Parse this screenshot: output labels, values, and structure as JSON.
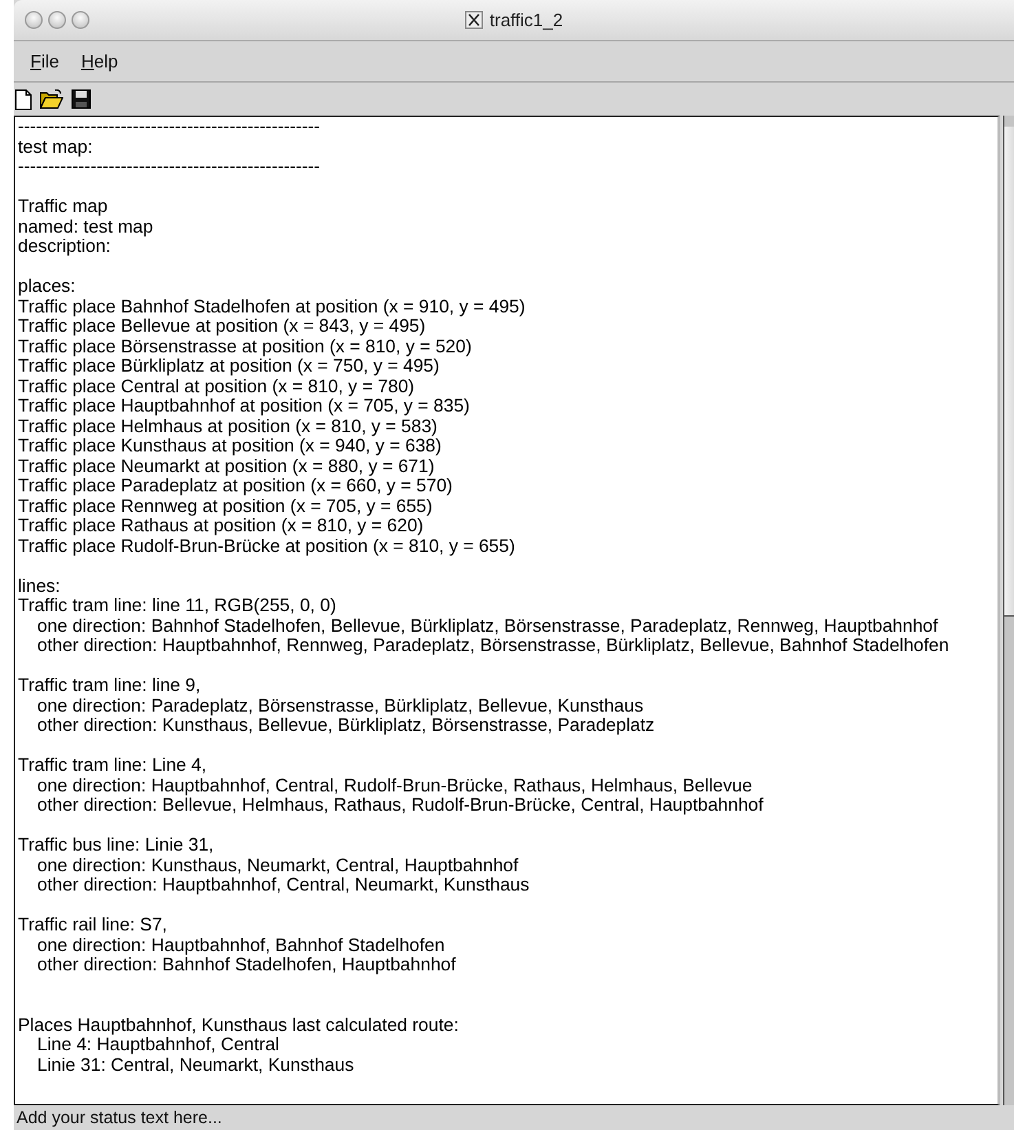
{
  "window": {
    "title": "traffic1_2"
  },
  "menu": [
    {
      "label": "File"
    },
    {
      "label": "Help"
    }
  ],
  "log": [
    {
      "kind": "line",
      "text": "--------------------------------------------------"
    },
    {
      "kind": "line",
      "text": "test map:"
    },
    {
      "kind": "line",
      "text": "--------------------------------------------------"
    },
    {
      "kind": "blank"
    },
    {
      "kind": "line",
      "text": "Traffic map"
    },
    {
      "kind": "line",
      "text": "named: test map"
    },
    {
      "kind": "line",
      "text": "description:"
    },
    {
      "kind": "blank"
    },
    {
      "kind": "line",
      "text": "places:"
    },
    {
      "kind": "line",
      "text": "Traffic place Bahnhof Stadelhofen at position (x = 910, y = 495)"
    },
    {
      "kind": "line",
      "text": "Traffic place Bellevue at position (x = 843, y = 495)"
    },
    {
      "kind": "line",
      "text": "Traffic place Börsenstrasse at position (x = 810, y = 520)"
    },
    {
      "kind": "line",
      "text": "Traffic place Bürkliplatz at position (x = 750, y = 495)"
    },
    {
      "kind": "line",
      "text": "Traffic place Central at position (x = 810, y = 780)"
    },
    {
      "kind": "line",
      "text": "Traffic place Hauptbahnhof at position (x = 705, y = 835)"
    },
    {
      "kind": "line",
      "text": "Traffic place Helmhaus at position (x = 810, y = 583)"
    },
    {
      "kind": "line",
      "text": "Traffic place Kunsthaus at position (x = 940, y = 638)"
    },
    {
      "kind": "line",
      "text": "Traffic place Neumarkt at position (x = 880, y = 671)"
    },
    {
      "kind": "line",
      "text": "Traffic place Paradeplatz at position (x = 660, y = 570)"
    },
    {
      "kind": "line",
      "text": "Traffic place Rennweg at position (x = 705, y = 655)"
    },
    {
      "kind": "line",
      "text": "Traffic place Rathaus at position (x = 810, y = 620)"
    },
    {
      "kind": "line",
      "text": "Traffic place Rudolf-Brun-Brücke at position (x = 810, y = 655)"
    },
    {
      "kind": "blank"
    },
    {
      "kind": "line",
      "text": "lines:"
    },
    {
      "kind": "line",
      "text": "Traffic tram line: line 11, RGB(255, 0, 0)"
    },
    {
      "kind": "indented",
      "text": "one direction: Bahnhof Stadelhofen, Bellevue, Bürkliplatz, Börsenstrasse, Paradeplatz, Rennweg, Hauptbahnhof"
    },
    {
      "kind": "indented",
      "text": "other direction: Hauptbahnhof, Rennweg, Paradeplatz, Börsenstrasse, Bürkliplatz, Bellevue, Bahnhof Stadelhofen"
    },
    {
      "kind": "blank"
    },
    {
      "kind": "line",
      "text": "Traffic tram line: line 9,"
    },
    {
      "kind": "indented",
      "text": "one direction: Paradeplatz, Börsenstrasse, Bürkliplatz, Bellevue, Kunsthaus"
    },
    {
      "kind": "indented",
      "text": "other direction: Kunsthaus, Bellevue, Bürkliplatz, Börsenstrasse, Paradeplatz"
    },
    {
      "kind": "blank"
    },
    {
      "kind": "line",
      "text": "Traffic tram line: Line 4,"
    },
    {
      "kind": "indented",
      "text": "one direction: Hauptbahnhof, Central, Rudolf-Brun-Brücke, Rathaus, Helmhaus, Bellevue"
    },
    {
      "kind": "indented",
      "text": "other direction: Bellevue, Helmhaus, Rathaus, Rudolf-Brun-Brücke, Central, Hauptbahnhof"
    },
    {
      "kind": "blank"
    },
    {
      "kind": "line",
      "text": "Traffic bus line: Linie 31,"
    },
    {
      "kind": "indented",
      "text": "one direction: Kunsthaus, Neumarkt, Central, Hauptbahnhof"
    },
    {
      "kind": "indented",
      "text": "other direction: Hauptbahnhof, Central, Neumarkt, Kunsthaus"
    },
    {
      "kind": "blank"
    },
    {
      "kind": "line",
      "text": "Traffic rail line: S7,"
    },
    {
      "kind": "indented",
      "text": "one direction: Hauptbahnhof, Bahnhof Stadelhofen"
    },
    {
      "kind": "indented",
      "text": "other direction: Bahnhof Stadelhofen, Hauptbahnhof"
    },
    {
      "kind": "blank"
    },
    {
      "kind": "blank"
    },
    {
      "kind": "line",
      "text": "Places Hauptbahnhof, Kunsthaus last calculated route:"
    },
    {
      "kind": "indented",
      "text": "Line 4: Hauptbahnhof, Central"
    },
    {
      "kind": "indented",
      "text": "Linie 31: Central, Neumarkt, Kunsthaus"
    }
  ],
  "status_bar": "Add your status text here..."
}
